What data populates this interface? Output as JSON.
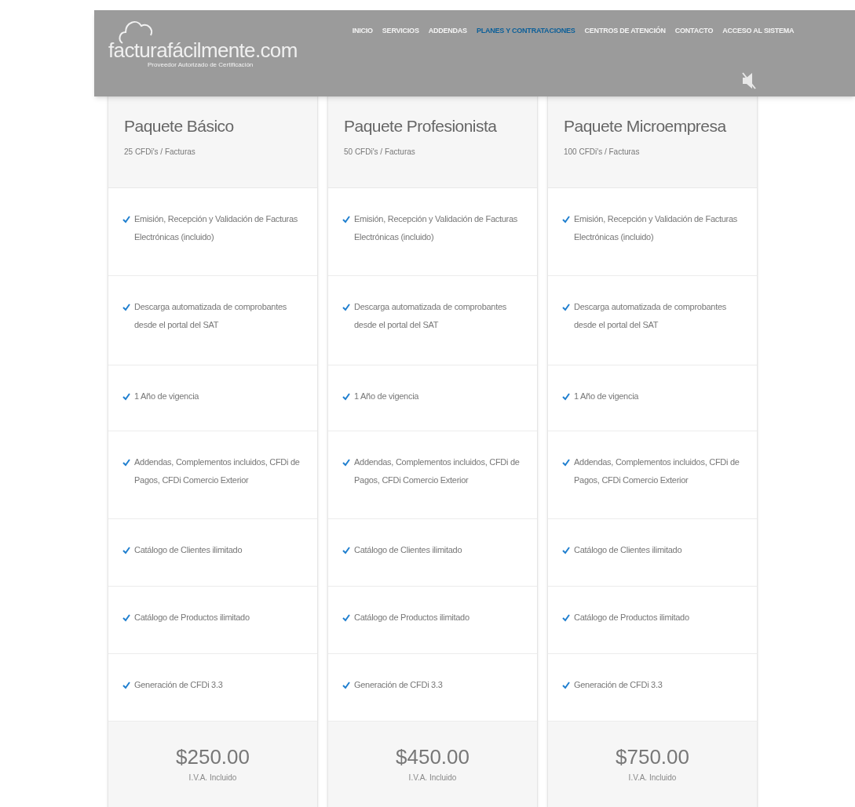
{
  "logo": {
    "name": "facturafácilmente.com",
    "tagline": "Proveedor Autorizado de Certificación"
  },
  "nav": [
    {
      "label": "INICIO",
      "selected": false
    },
    {
      "label": "SERVICIOS",
      "selected": false
    },
    {
      "label": "ADDENDAS",
      "selected": false
    },
    {
      "label": "PLANES Y CONTRATACIONES",
      "selected": true
    },
    {
      "label": "CENTROS DE ATENCIÓN",
      "selected": false
    },
    {
      "label": "CONTACTO",
      "selected": false
    },
    {
      "label": "ACCESO AL SISTEMA",
      "selected": false
    }
  ],
  "plans": [
    {
      "title": "Paquete Básico",
      "subtitle": "25 CFDi's / Facturas",
      "features": [
        "Emisión, Recepción y Validación de Facturas Electrónicas (incluido)",
        "Descarga automatizada de comprobantes desde el portal del SAT",
        "1 Año de vigencia",
        "Addendas, Complementos incluidos, CFDi de Pagos, CFDi Comercio Exterior",
        "Catálogo de Clientes ilimitado",
        "Catálogo de Productos ilimitado",
        "Generación de CFDi 3.3"
      ],
      "price": "$250.00",
      "price_note": "I.V.A. Incluido"
    },
    {
      "title": "Paquete Profesionista",
      "subtitle": "50 CFDi's / Facturas",
      "features": [
        "Emisión, Recepción y Validación de Facturas Electrónicas (incluido)",
        "Descarga automatizada de comprobantes desde el portal del SAT",
        "1 Año de vigencia",
        "Addendas, Complementos incluidos, CFDi de Pagos, CFDi Comercio Exterior",
        "Catálogo de Clientes ilimitado",
        "Catálogo de Productos ilimitado",
        "Generación de CFDi 3.3"
      ],
      "price": "$450.00",
      "price_note": "I.V.A. Incluido"
    },
    {
      "title": "Paquete Microempresa",
      "subtitle": "100 CFDi's / Facturas",
      "features": [
        "Emisión, Recepción y Validación de Facturas Electrónicas (incluido)",
        "Descarga automatizada de comprobantes desde el portal del SAT",
        "1 Año de vigencia",
        "Addendas, Complementos incluidos, CFDi de Pagos, CFDi Comercio Exterior",
        "Catálogo de Clientes ilimitado",
        "Catálogo de Productos ilimitado",
        "Generación de CFDi 3.3"
      ],
      "price": "$750.00",
      "price_note": "I.V.A. Incluido"
    }
  ]
}
